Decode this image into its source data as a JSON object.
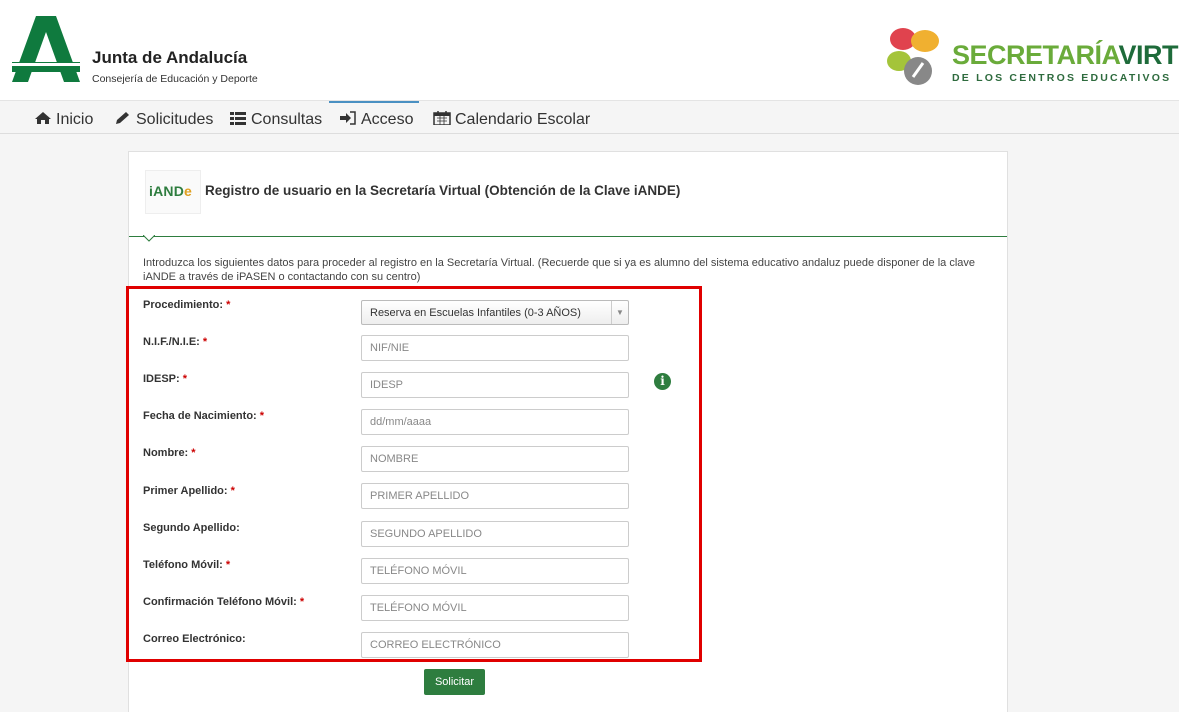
{
  "header": {
    "brand_title": "Junta de Andalucía",
    "brand_subtitle": "Consejería de Educación y Deporte",
    "sv_title_part1": "SECRETARÍA",
    "sv_title_part2": "VIRTUAL",
    "sv_subtitle": "DE LOS CENTROS EDUCATIVOS"
  },
  "nav": {
    "items": [
      {
        "label": "Inicio",
        "icon": "home-icon"
      },
      {
        "label": "Solicitudes",
        "icon": "pencil-icon"
      },
      {
        "label": "Consultas",
        "icon": "list-icon"
      },
      {
        "label": "Acceso",
        "icon": "sign-in-icon",
        "active": true
      },
      {
        "label": "Calendario Escolar",
        "icon": "calendar-icon"
      }
    ]
  },
  "panel": {
    "logo_text_main": "iAND",
    "logo_text_e": "e",
    "title": "Registro de usuario en la Secretaría Virtual (Obtención de la Clave iANDE)",
    "intro": "Introduzca los siguientes datos para proceder al registro en la Secretaría Virtual. (Recuerde que si ya es alumno del sistema educativo andaluz puede disponer de la clave iANDE a través de iPASEN o contactando con su centro)"
  },
  "form": {
    "required_mark": "*",
    "procedimiento": {
      "label": "Procedimiento:",
      "value": "Reserva en Escuelas Infantiles (0-3 AÑOS)"
    },
    "nif": {
      "label": "N.I.F./N.I.E:",
      "placeholder": "NIF/NIE"
    },
    "idesp": {
      "label": "IDESP:",
      "placeholder": "IDESP"
    },
    "fecha": {
      "label": "Fecha de Nacimiento:",
      "placeholder": "dd/mm/aaaa"
    },
    "nombre": {
      "label": "Nombre:",
      "placeholder": "NOMBRE"
    },
    "apellido1": {
      "label": "Primer Apellido:",
      "placeholder": "PRIMER APELLIDO"
    },
    "apellido2": {
      "label": "Segundo Apellido:",
      "placeholder": "SEGUNDO APELLIDO"
    },
    "telefono": {
      "label": "Teléfono Móvil:",
      "placeholder": "TELÉFONO MÓVIL"
    },
    "telefono_conf": {
      "label": "Confirmación Teléfono Móvil:",
      "placeholder": "TELÉFONO MÓVIL"
    },
    "correo": {
      "label": "Correo Electrónico:",
      "placeholder": "CORREO ELECTRÓNICO"
    },
    "submit_label": "Solicitar"
  },
  "colors": {
    "accent_green": "#2e7d3f",
    "highlight_red": "#e00000",
    "nav_active": "#4a90c2"
  }
}
